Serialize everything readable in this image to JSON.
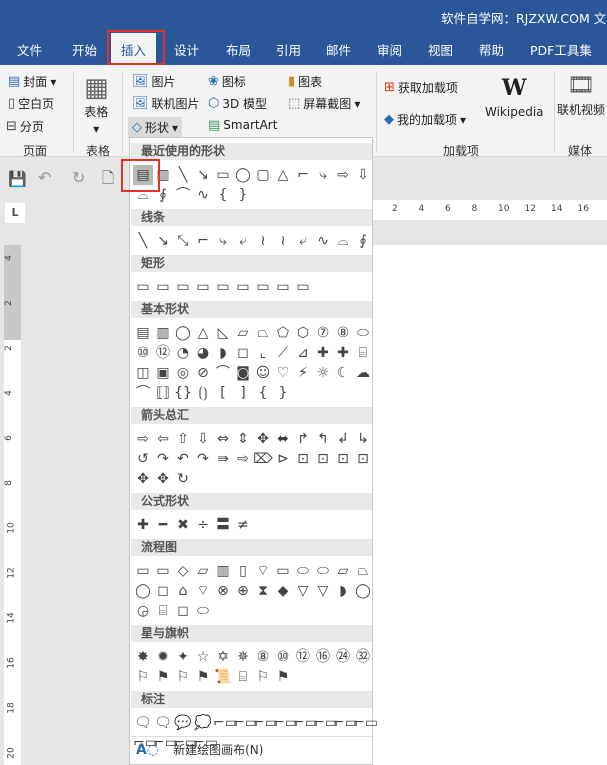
{
  "window": {
    "title": "软件自学网：RJZXW.COM  文"
  },
  "tabs": [
    "文件",
    "开始",
    "插入",
    "设计",
    "布局",
    "引用",
    "邮件",
    "审阅",
    "视图",
    "帮助",
    "PDF工具集"
  ],
  "active_tab": "插入",
  "ribbon": {
    "page": {
      "cover": "封面",
      "blank": "空白页",
      "break": "分页",
      "group": "页面"
    },
    "table": {
      "label": "表格",
      "group": "表格"
    },
    "illustrations": {
      "picture": "图片",
      "online_picture": "联机图片",
      "shapes": "形状",
      "icons": "图标",
      "model3d": "3D 模型",
      "smartart": "SmartArt",
      "chart": "图表",
      "screenshot": "屏幕截图"
    },
    "addins": {
      "get": "获取加载项",
      "mine": "我的加载项",
      "wikipedia": "Wikipedia",
      "group": "加载项"
    },
    "media": {
      "video": "联机视频",
      "group": "媒体"
    }
  },
  "hruler": [
    "2",
    "4",
    "6",
    "8",
    "10",
    "12",
    "14",
    "16"
  ],
  "vruler": [
    "4",
    "2",
    "2",
    "4",
    "6",
    "8",
    "10",
    "12",
    "14",
    "16",
    "18",
    "20"
  ],
  "shapes_menu": {
    "sections": [
      {
        "title": "最近使用的形状",
        "rows": [
          [
            "▤",
            "▥",
            "╲",
            "↘",
            "▭",
            "◯",
            "▢",
            "△",
            "⌐",
            "⤷",
            "⇨",
            "⇩"
          ],
          [
            "⌓",
            "∮",
            "⌒",
            "∿",
            "{",
            "}"
          ]
        ]
      },
      {
        "title": "线条",
        "rows": [
          [
            "╲",
            "↘",
            "⤡",
            "⌐",
            "⤷",
            "⤶",
            "≀",
            "≀",
            "⤶",
            "∿",
            "⌓",
            "∮"
          ]
        ]
      },
      {
        "title": "矩形",
        "rows": [
          [
            "▭",
            "▭",
            "▭",
            "▭",
            "▭",
            "▭",
            "▭",
            "▭",
            "▭"
          ]
        ]
      },
      {
        "title": "基本形状",
        "rows": [
          [
            "▤",
            "▥",
            "◯",
            "△",
            "◺",
            "▱",
            "⏢",
            "⬠",
            "⬡",
            "⑦",
            "⑧",
            "⬭"
          ],
          [
            "⑩",
            "⑫",
            "◔",
            "◕",
            "◗",
            "◻",
            "⌞",
            "⟋",
            "⊿",
            "✚",
            "✚",
            "⌸"
          ],
          [
            "◫",
            "▣",
            "◎",
            "⊘",
            "⌒",
            "◙",
            "☺",
            "♡",
            "⚡",
            "☼",
            "☾",
            "☁"
          ],
          [
            "⌒",
            "⟦⟧",
            "{}",
            "⟮⟯",
            "[",
            "]",
            "{",
            "}"
          ]
        ]
      },
      {
        "title": "箭头总汇",
        "rows": [
          [
            "⇨",
            "⇦",
            "⇧",
            "⇩",
            "⇔",
            "⇕",
            "✥",
            "⬌",
            "↱",
            "↰",
            "↲",
            "↳"
          ],
          [
            "↺",
            "↷",
            "↶",
            "↷",
            "⇛",
            "⇨",
            "⌦",
            "⊳",
            "⊡",
            "⊡",
            "⊡",
            "⊡"
          ],
          [
            "✥",
            "✥",
            "↻"
          ]
        ]
      },
      {
        "title": "公式形状",
        "rows": [
          [
            "✚",
            "━",
            "✖",
            "÷",
            "〓",
            "≠"
          ]
        ]
      },
      {
        "title": "流程图",
        "rows": [
          [
            "▭",
            "▭",
            "◇",
            "▱",
            "▥",
            "▯",
            "⌔",
            "▭",
            "⬭",
            "⬭",
            "▱",
            "⏢"
          ],
          [
            "◯",
            "◻",
            "⌂",
            "⌔",
            "⊗",
            "⊕",
            "⧗",
            "◆",
            "▽",
            "▽",
            "◗",
            "◯"
          ],
          [
            "◶",
            "⌸",
            "◻",
            "⬭"
          ]
        ]
      },
      {
        "title": "星与旗帜",
        "rows": [
          [
            "✸",
            "✹",
            "✦",
            "☆",
            "✡",
            "✵",
            "⑧",
            "⑩",
            "⑫",
            "⑯",
            "㉔",
            "㉜"
          ],
          [
            "⚐",
            "⚑",
            "⚐",
            "⚑",
            "📜",
            "⌸",
            "⚐",
            "⚑"
          ]
        ]
      },
      {
        "title": "标注",
        "rows": [
          [
            "🗨",
            "🗨",
            "💬",
            "💭",
            "⌐▭",
            "⌐▭",
            "⌐▭",
            "⌐▭",
            "⌐▭",
            "⌐▭",
            "⌐▭",
            "⌐▭"
          ],
          [
            "⌐▭",
            "⌐▭",
            "⌐▭",
            "⌐▭"
          ]
        ]
      }
    ],
    "new_canvas": "新建绘图画布(N)"
  }
}
